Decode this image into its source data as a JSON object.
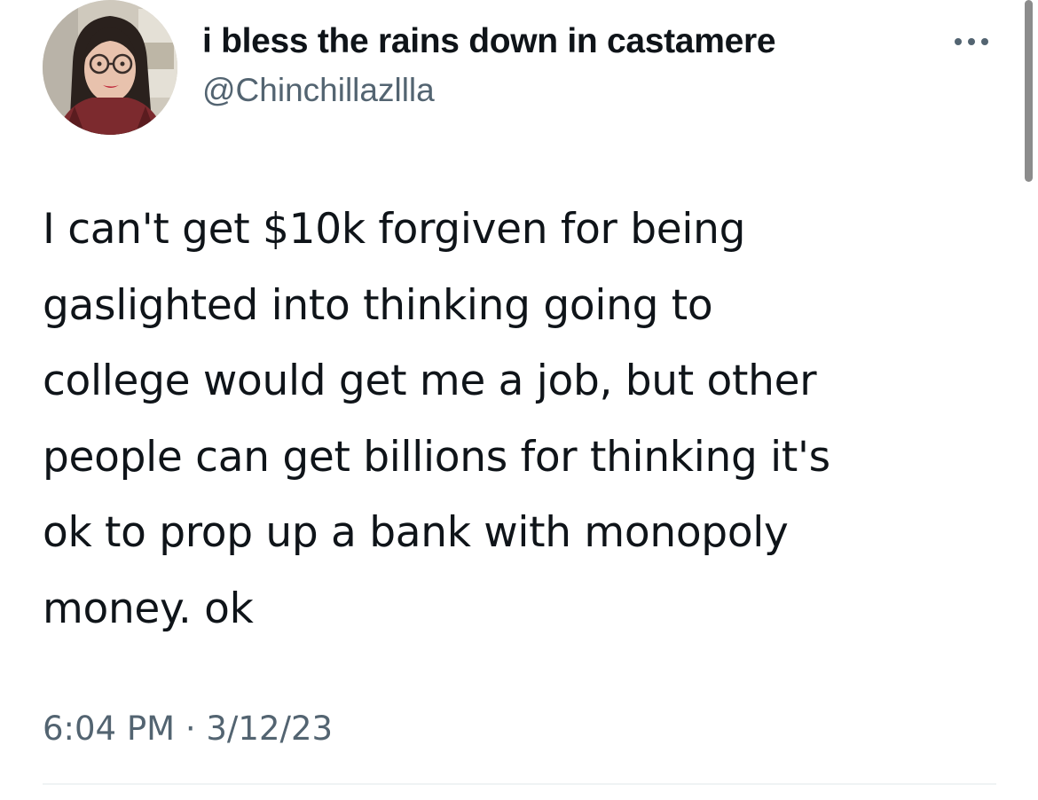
{
  "tweet": {
    "author": {
      "display_name": "i bless the rains down in castamere",
      "handle": "@Chinchillazllla",
      "avatar_icon": "profile-photo"
    },
    "more_icon": "more-options-icon",
    "text": "I can't get $10k forgiven for being\ngaslighted into thinking going to\ncollege would get me a job, but other\npeople can get billions for thinking it's\nok to prop up a bank with monopoly\nmoney. ok",
    "time": "6:04 PM",
    "separator": " · ",
    "date": "3/12/23"
  },
  "colors": {
    "text_primary": "#0f1419",
    "text_secondary": "#536471",
    "divider": "#eff3f4"
  }
}
